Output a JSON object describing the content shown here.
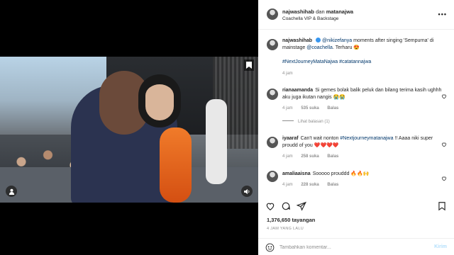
{
  "post": {
    "author": "najwashihab",
    "joiner": "dan",
    "coauthor": "matanajwa",
    "location": "Coachella VIP & Backstage",
    "more_glyph": "•••"
  },
  "caption": {
    "user": "najwashihab",
    "mention1": "@nikizefanya",
    "text1": " moments after singing 'Sempurna' di mainstage ",
    "mention2": "@coachella",
    "text2": ". Terharu 😍",
    "hashtags": "#NextJourneyMataNajwa #catatannajwa",
    "time": "4 jam"
  },
  "comments": [
    {
      "user": "rianaamanda",
      "text": "Si gemes bolak balik peluk dan bilang terima kasih ughhh aku juga ikutan nangis 😭😭",
      "time": "4 jam",
      "likes": "535 suka",
      "reply": "Balas",
      "replies_label": "Lihat balasan (1)"
    },
    {
      "user": "iyaaraf",
      "text_before": "Can't wait nonton ",
      "hashtag": "#Nextjourneymatanajwa",
      "text_after": " !! Aaaa niki super proudd of you ❤️❤️❤️❤️",
      "time": "4 jam",
      "likes": "258 suka",
      "reply": "Balas"
    },
    {
      "user": "amaliaaisna",
      "text": "Sooooo prouddd 🔥🔥🙌",
      "time": "4 jam",
      "likes": "228 suka",
      "reply": "Balas"
    }
  ],
  "stats": {
    "views": "1,376,650 tayangan",
    "date": "4 JAM YANG LALU"
  },
  "composer": {
    "placeholder": "Tambahkan komentar...",
    "post_label": "Kirim"
  },
  "icons": {
    "video_user": "user-icon",
    "video_sound": "sound-icon",
    "bookmark_overlay": "bookmark-icon"
  },
  "colors": {
    "link": "#00376b",
    "verified": "#3897f0",
    "post_button": "#b2dffc"
  }
}
